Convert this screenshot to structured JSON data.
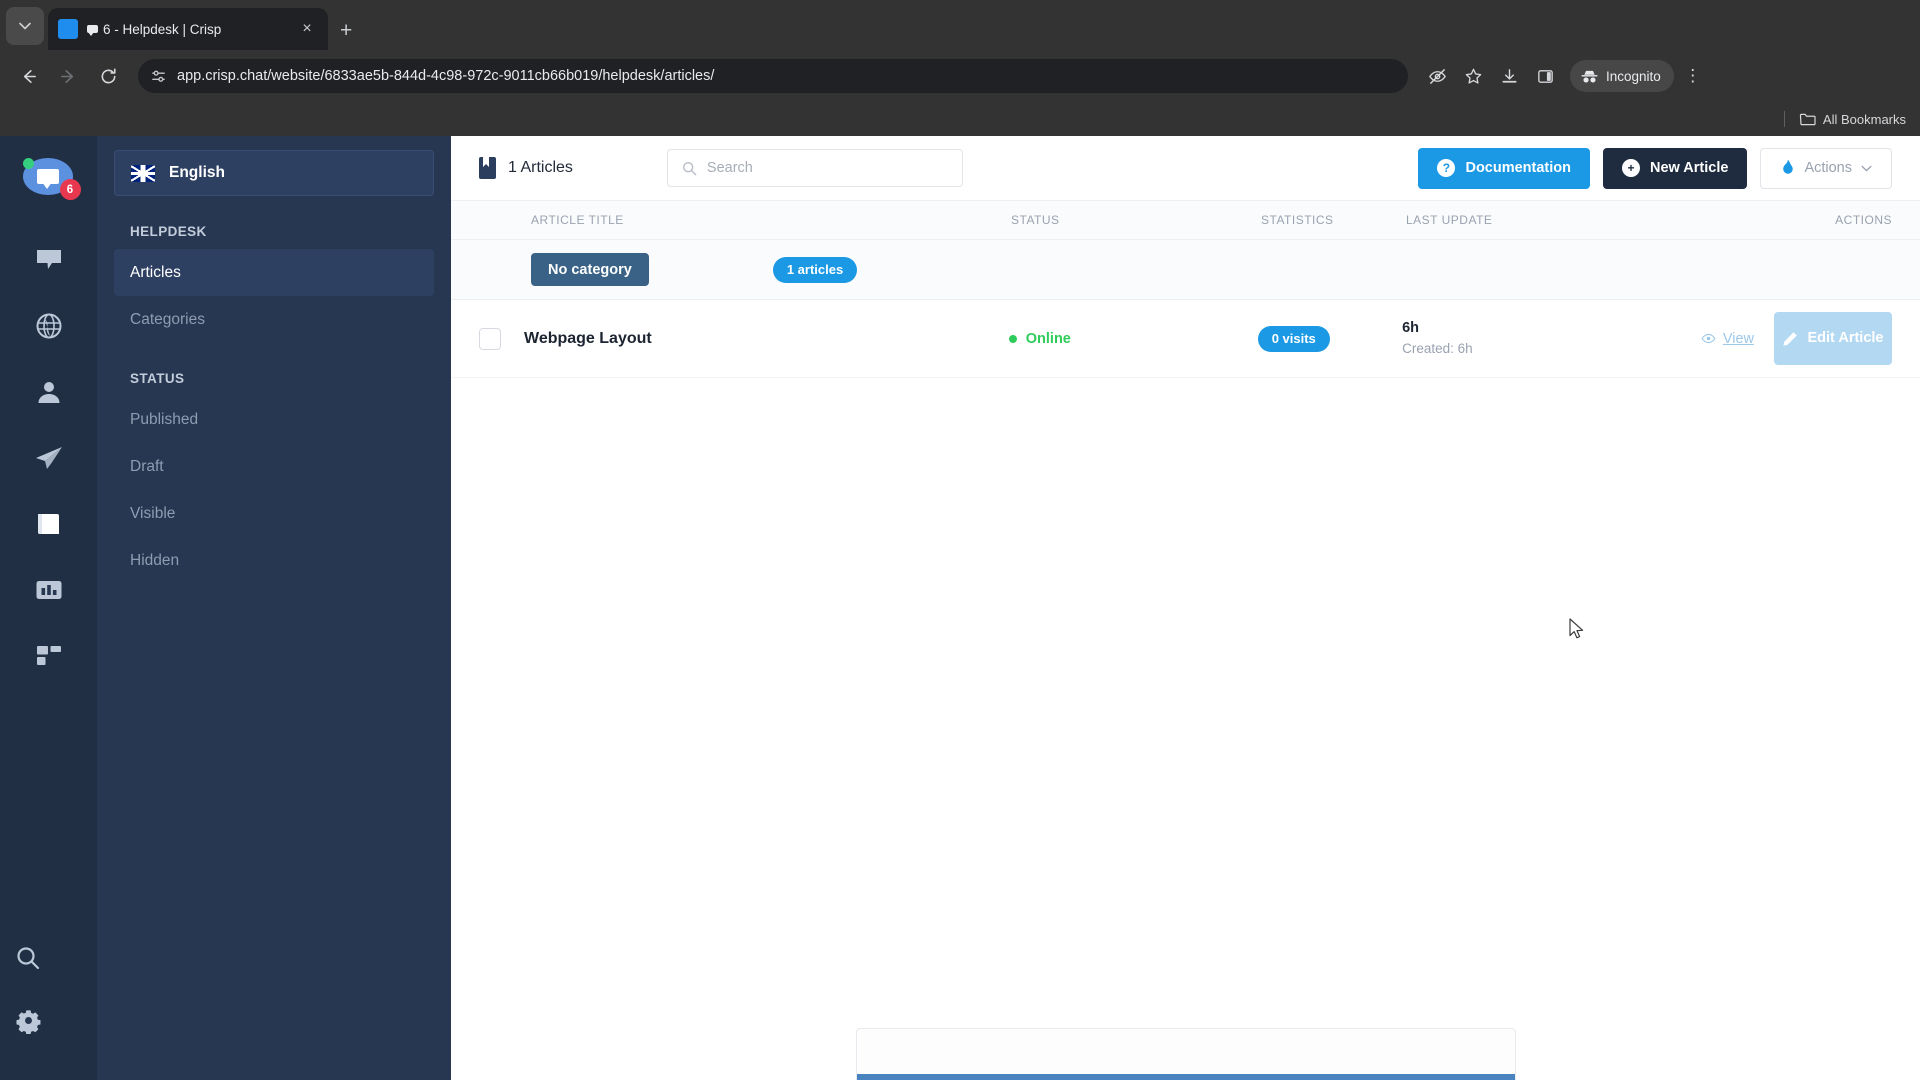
{
  "browser": {
    "tab": {
      "title": "6 - Helpdesk | Crisp",
      "favicon_name": "crisp-chat-favicon",
      "close_label": "×"
    },
    "new_tab_label": "+",
    "tab_search_label": "⌄",
    "nav": {
      "back_label": "←",
      "forward_label": "→",
      "reload_label": "⟳"
    },
    "omnibox": {
      "url": "app.crisp.chat/website/6833ae5b-844d-4c98-972c-9011cb66b019/helpdesk/articles/",
      "site_info_icon": "page-settings-icon"
    },
    "toolbar_icons": [
      "eye-slash-icon",
      "star-icon",
      "download-icon",
      "side-panel-icon"
    ],
    "incognito_label": "Incognito",
    "menu_label": "⋮",
    "bookmarks": {
      "all_bookmarks_label": "All Bookmarks"
    }
  },
  "rail": {
    "logo": {
      "unread_badge": "6",
      "presence": "online"
    },
    "items": [
      {
        "name": "conversations",
        "icon": "chat-bubble-icon"
      },
      {
        "name": "website",
        "icon": "globe-icon"
      },
      {
        "name": "contacts",
        "icon": "user-icon"
      },
      {
        "name": "campaigns",
        "icon": "paper-plane-icon"
      },
      {
        "name": "helpdesk",
        "icon": "book-icon"
      },
      {
        "name": "analytics",
        "icon": "bar-chart-icon"
      },
      {
        "name": "plugins",
        "icon": "grid-blocks-icon"
      }
    ],
    "bottom_items": [
      {
        "name": "search",
        "icon": "magnifier-icon"
      },
      {
        "name": "settings",
        "icon": "gear-icon"
      }
    ]
  },
  "sidebar": {
    "language": {
      "label": "English",
      "flag": "uk-flag-icon"
    },
    "sections": [
      {
        "title": "HELPDESK",
        "items": [
          {
            "label": "Articles",
            "active": true
          },
          {
            "label": "Categories",
            "active": false
          }
        ]
      },
      {
        "title": "STATUS",
        "items": [
          {
            "label": "Published",
            "active": false
          },
          {
            "label": "Draft",
            "active": false
          },
          {
            "label": "Visible",
            "active": false
          },
          {
            "label": "Hidden",
            "active": false
          }
        ]
      }
    ]
  },
  "topbar": {
    "count_label": "1 Articles",
    "count_icon": "bookmark-book-icon",
    "search_placeholder": "Search",
    "search_value": "",
    "documentation_label": "Documentation",
    "documentation_icon": "question-circle-icon",
    "new_article_label": "New Article",
    "new_article_icon": "plus-circle-icon",
    "actions_label": "Actions",
    "actions_icon": "flame-icon",
    "actions_caret": "⌄"
  },
  "table": {
    "headers": {
      "title": "ARTICLE TITLE",
      "status": "STATUS",
      "statistics": "STATISTICS",
      "last_update": "LAST UPDATE",
      "actions": "ACTIONS"
    },
    "category_group": {
      "badge": "No category",
      "count_pill": "1 articles"
    },
    "rows": [
      {
        "title": "Webpage Layout",
        "checked": false,
        "status": "Online",
        "status_color": "#2ecc5a",
        "visits": "0 visits",
        "last_update": "6h",
        "created": "Created: 6h",
        "view_label": "View",
        "edit_label": "Edit Article"
      }
    ]
  },
  "colors": {
    "accent_blue": "#1b99e5",
    "dark_navy": "#1f2c3f",
    "rail_bg": "#212f44",
    "sidebar_bg": "#273751",
    "online_green": "#2ecc5a",
    "badge_red": "#e8384f"
  }
}
